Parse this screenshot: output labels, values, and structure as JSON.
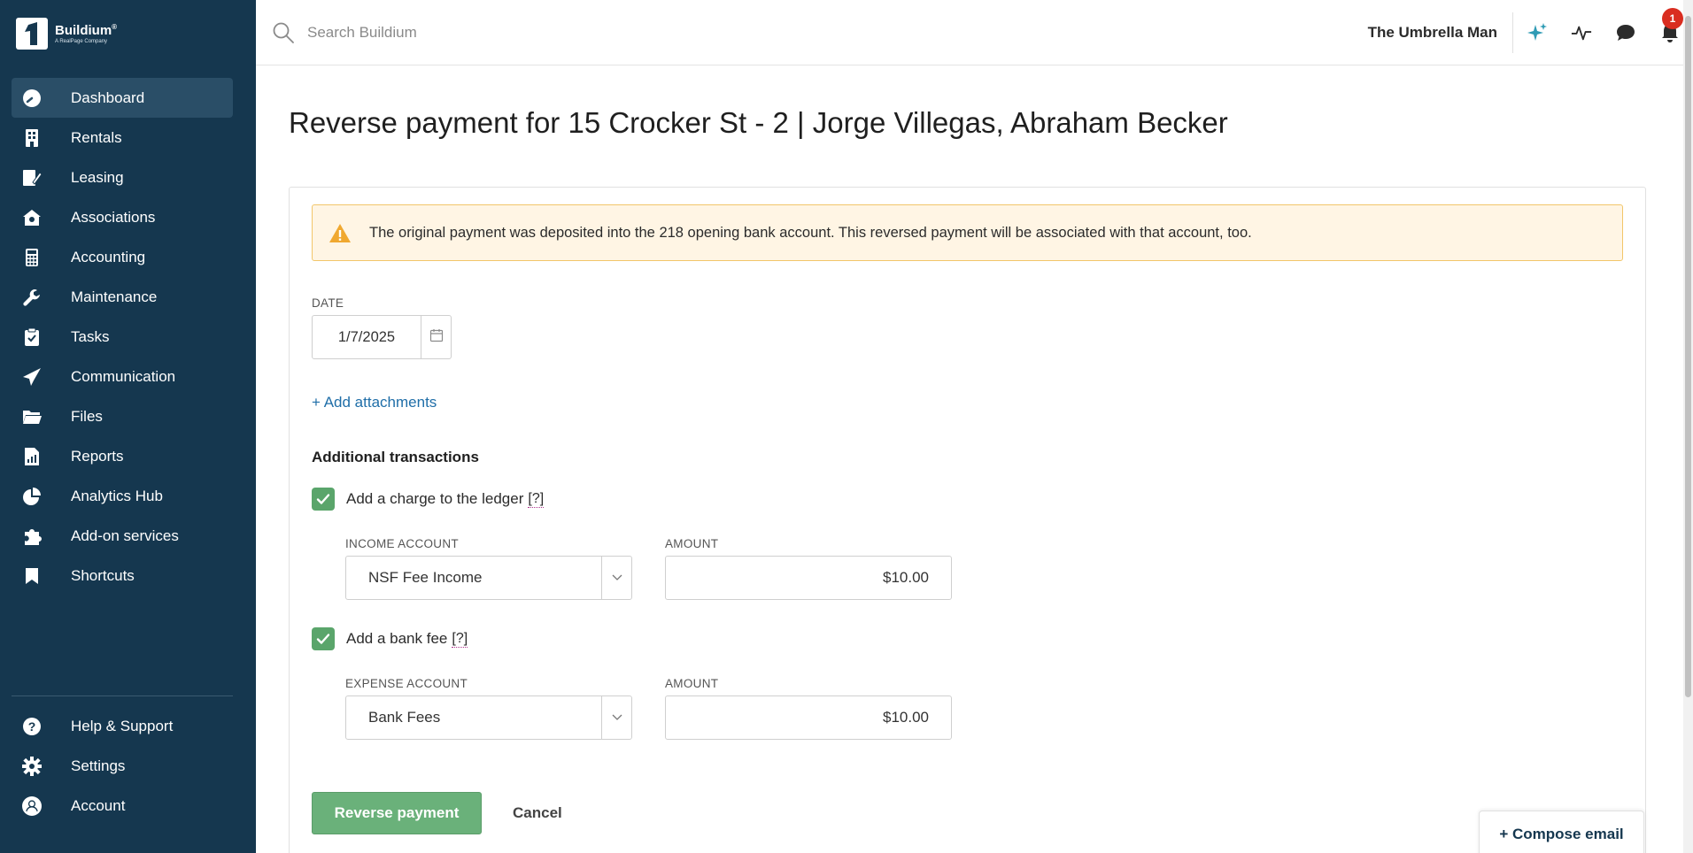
{
  "brand": {
    "name": "Buildium",
    "registered": "®",
    "sub": "A RealPage Company"
  },
  "sidebar": {
    "items": [
      {
        "label": "Dashboard",
        "icon": "dashboard-icon",
        "active": true
      },
      {
        "label": "Rentals",
        "icon": "building-icon"
      },
      {
        "label": "Leasing",
        "icon": "lease-icon"
      },
      {
        "label": "Associations",
        "icon": "association-icon"
      },
      {
        "label": "Accounting",
        "icon": "calculator-icon"
      },
      {
        "label": "Maintenance",
        "icon": "wrench-icon"
      },
      {
        "label": "Tasks",
        "icon": "clipboard-icon"
      },
      {
        "label": "Communication",
        "icon": "megaphone-icon"
      },
      {
        "label": "Files",
        "icon": "folder-icon"
      },
      {
        "label": "Reports",
        "icon": "report-icon"
      },
      {
        "label": "Analytics Hub",
        "icon": "pie-chart-icon"
      },
      {
        "label": "Add-on services",
        "icon": "puzzle-icon"
      },
      {
        "label": "Shortcuts",
        "icon": "bookmark-icon"
      }
    ],
    "bottom": [
      {
        "label": "Help & Support",
        "icon": "help-icon"
      },
      {
        "label": "Settings",
        "icon": "gear-icon"
      },
      {
        "label": "Account",
        "icon": "user-icon"
      }
    ]
  },
  "topbar": {
    "search_placeholder": "Search Buildium",
    "org_name": "The Umbrella Man",
    "notification_count": "1"
  },
  "page": {
    "title": "Reverse payment for 15 Crocker St - 2 | Jorge Villegas, Abraham Becker",
    "alert": "The original payment was deposited into the 218 opening bank account. This reversed payment will be associated with that account, too.",
    "date_label": "DATE",
    "date_value": "1/7/2025",
    "add_attachments": "+ Add attachments",
    "additional_title": "Additional transactions",
    "charge": {
      "label": "Add a charge to the ledger",
      "help": "[?]",
      "account_label": "INCOME ACCOUNT",
      "account_value": "NSF Fee Income",
      "amount_label": "AMOUNT",
      "amount_value": "$10.00",
      "checked": true
    },
    "bank_fee": {
      "label": "Add a bank fee",
      "help": "[?]",
      "account_label": "EXPENSE ACCOUNT",
      "account_value": "Bank Fees",
      "amount_label": "AMOUNT",
      "amount_value": "$10.00",
      "checked": true
    },
    "submit": "Reverse payment",
    "cancel": "Cancel",
    "compose": "+ Compose email"
  },
  "colors": {
    "sidebar_bg": "#15374f",
    "active_item": "#2a4e67",
    "link": "#1f6ea8",
    "primary_button": "#6ab17a",
    "checkbox": "#5aa56b",
    "alert_bg": "#fff5e4",
    "alert_border": "#f2c66a",
    "badge": "#d92d20"
  }
}
